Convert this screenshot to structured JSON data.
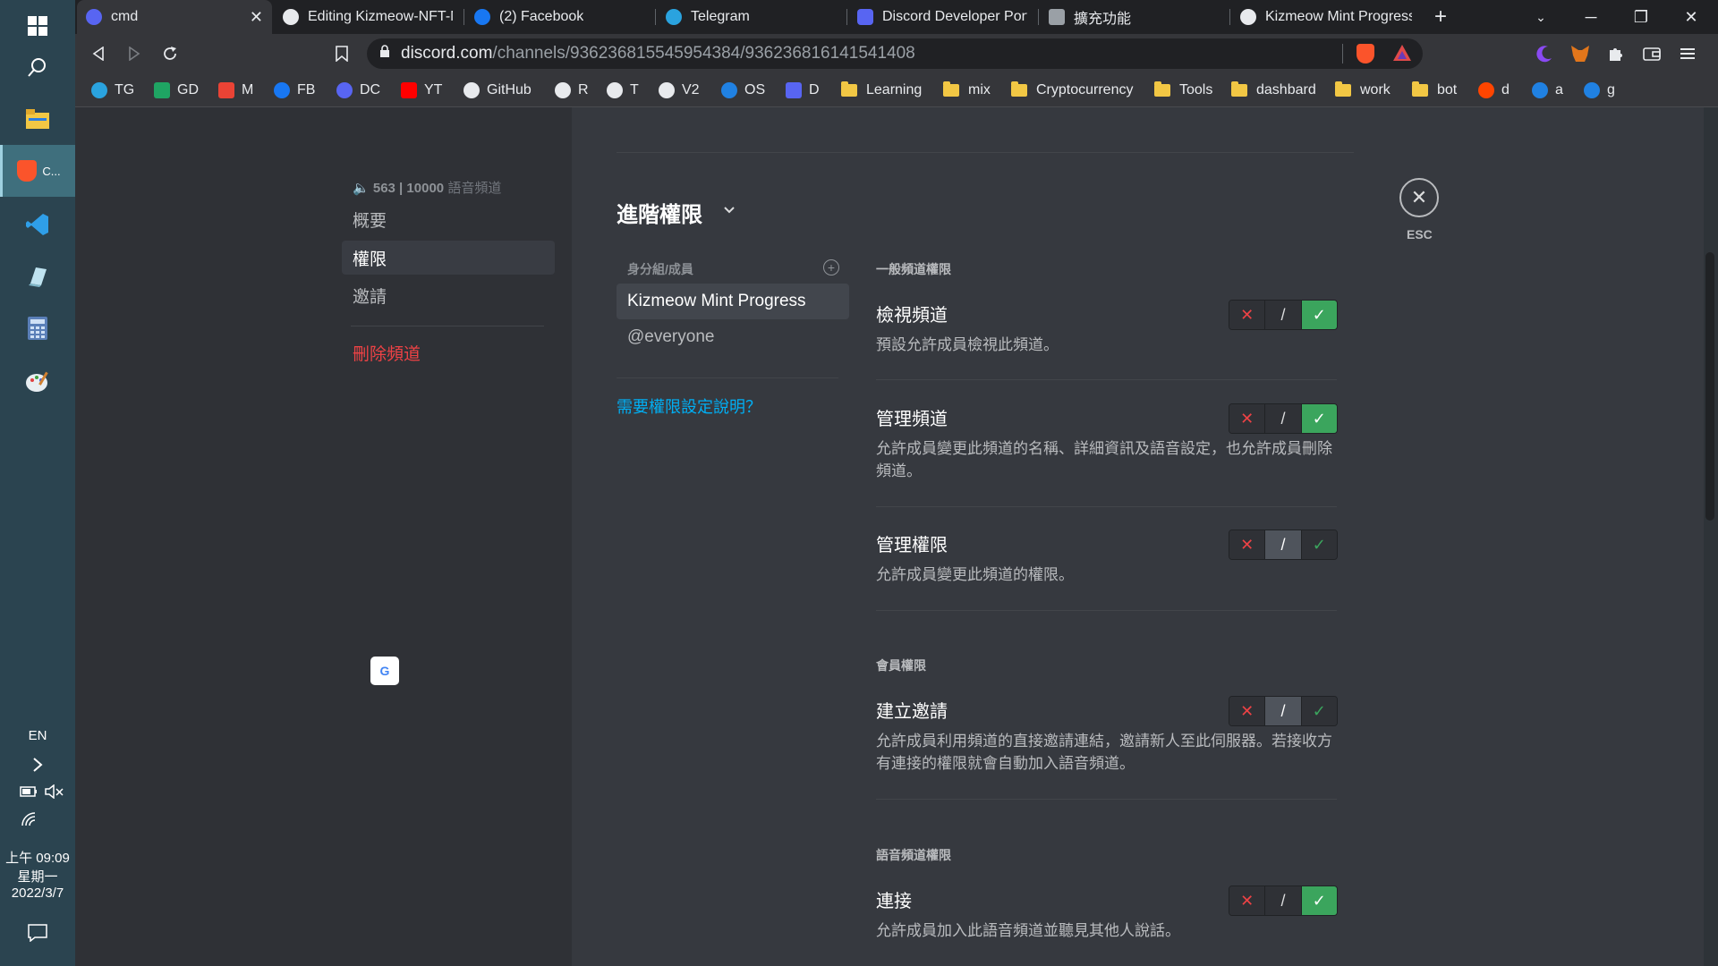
{
  "taskbar": {
    "active_label": "C...",
    "lang": "EN",
    "time": "上午 09:09",
    "weekday": "星期一",
    "date": "2022/3/7"
  },
  "browser": {
    "tabs": [
      {
        "label": "cmd",
        "active": true
      },
      {
        "label": "Editing Kizmeow-NFT-M"
      },
      {
        "label": "(2) Facebook"
      },
      {
        "label": "Telegram"
      },
      {
        "label": "Discord Developer Porta"
      },
      {
        "label": "擴充功能"
      },
      {
        "label": "Kizmeow Mint Progress"
      }
    ],
    "url_host": "discord.com",
    "url_path": "/channels/936236815545954384/936236816141541408",
    "bookmarks": [
      "TG",
      "GD",
      "M",
      "FB",
      "DC",
      "YT",
      "GitHub",
      "R",
      "T",
      "V2",
      "OS",
      "D",
      "Learning",
      "mix",
      "Cryptocurrency",
      "Tools",
      "dashbard",
      "work",
      "bot",
      "d",
      "a",
      "g"
    ]
  },
  "sidebar": {
    "channel_header_count": "563 | 10000",
    "channel_header_suffix": "語音頻道",
    "items": [
      {
        "label": "概要"
      },
      {
        "label": "權限",
        "selected": true
      },
      {
        "label": "邀請"
      }
    ],
    "delete_label": "刪除頻道"
  },
  "main": {
    "title": "進階權限",
    "roles_header": "身分組/成員",
    "roles": [
      "Kizmeow Mint Progress",
      "@everyone"
    ],
    "help_link": "需要權限設定說明？",
    "esc_label": "ESC",
    "sections": [
      {
        "header": "一般頻道權限",
        "perms": [
          {
            "name": "檢視頻道",
            "desc": "預設允許成員檢視此頻道。",
            "state": "allow"
          },
          {
            "name": "管理頻道",
            "desc": "允許成員變更此頻道的名稱、詳細資訊及語音設定，也允許成員刪除頻道。",
            "state": "allow"
          },
          {
            "name": "管理權限",
            "desc": "允許成員變更此頻道的權限。",
            "state": "neutral"
          }
        ]
      },
      {
        "header": "會員權限",
        "perms": [
          {
            "name": "建立邀請",
            "desc": "允許成員利用頻道的直接邀請連結，邀請新人至此伺服器。若接收方有連接的權限就會自動加入語音頻道。",
            "state": "neutral"
          }
        ]
      },
      {
        "header": "語音頻道權限",
        "perms": [
          {
            "name": "連接",
            "desc": "允許成員加入此語音頻道並聽見其他人說話。",
            "state": "allow"
          }
        ]
      }
    ],
    "toggle_glyphs": {
      "deny": "✕",
      "neutral": "/",
      "allow": "✓"
    }
  },
  "colors": {
    "accent_link": "#00aff4",
    "danger": "#ed4245",
    "allow": "#3ba55d"
  }
}
